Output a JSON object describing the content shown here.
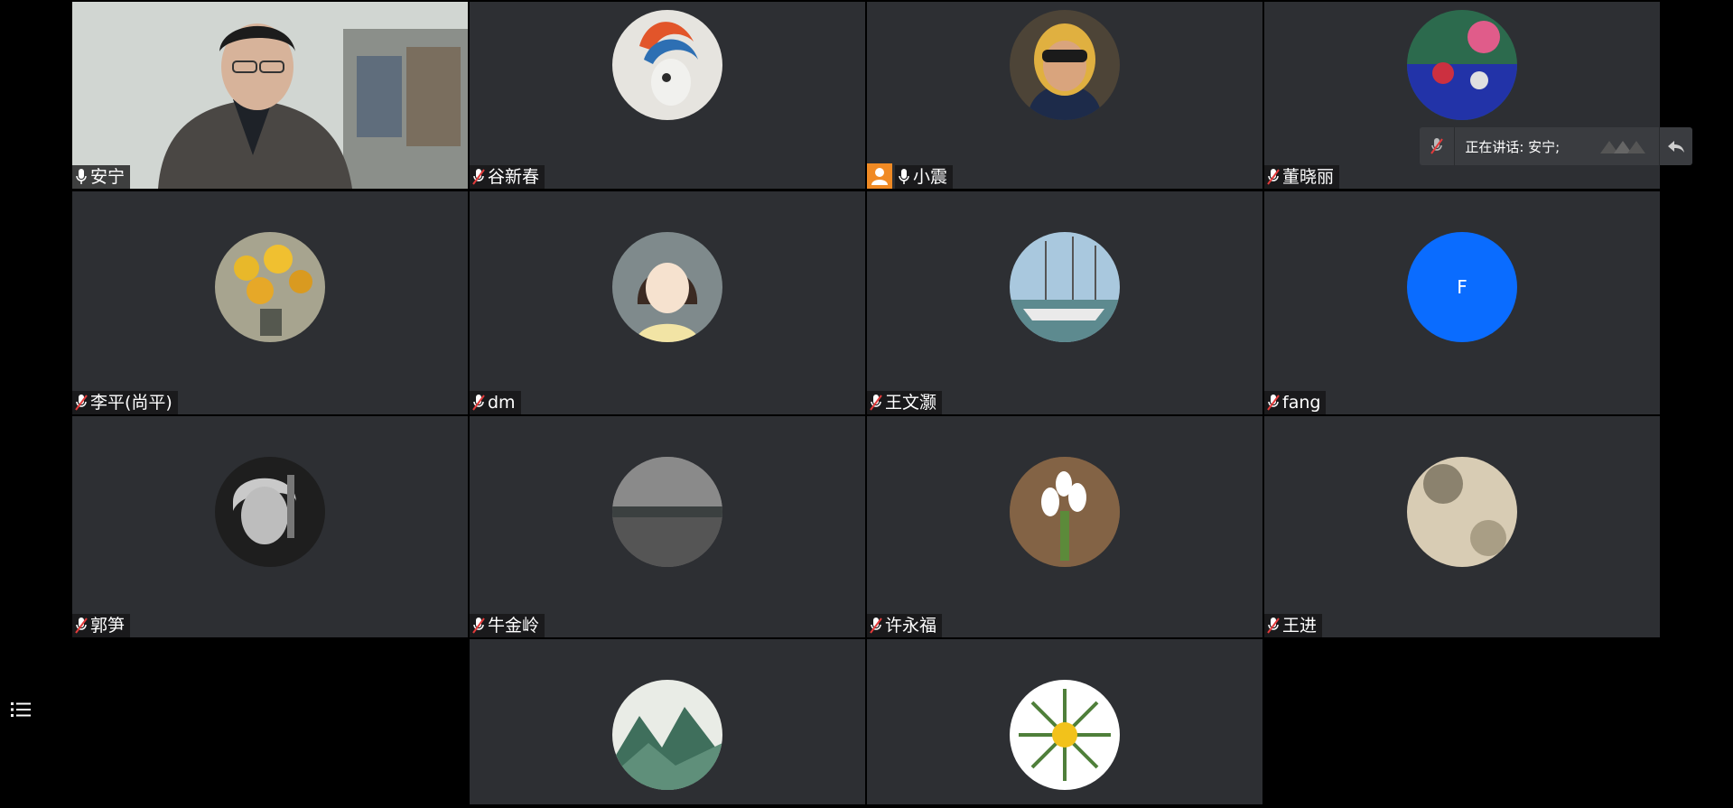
{
  "colors": {
    "tile_bg": "#2d2f33",
    "page_bg": "#000000",
    "speaking_outline": "#3fbf6f",
    "host_badge": "#f08a24",
    "letter_avatar": "#0a6cff"
  },
  "participants": [
    {
      "name": "安宁",
      "mic": "on",
      "video": "on"
    },
    {
      "name": "谷新春",
      "mic": "muted"
    },
    {
      "name": "小震",
      "mic": "on",
      "host": true
    },
    {
      "name": "董晓丽",
      "mic": "muted"
    },
    {
      "name": "李平(尚平)",
      "mic": "muted"
    },
    {
      "name": "dm",
      "mic": "muted"
    },
    {
      "name": "王文灏",
      "mic": "muted"
    },
    {
      "name": "fang",
      "mic": "muted",
      "initial": "F"
    },
    {
      "name": "郭笋",
      "mic": "muted"
    },
    {
      "name": "牛金岭",
      "mic": "muted"
    },
    {
      "name": "许永福",
      "mic": "muted"
    },
    {
      "name": "王进",
      "mic": "muted"
    },
    {
      "name": "",
      "mic": "muted"
    },
    {
      "name": "",
      "mic": "muted"
    }
  ],
  "speaker_panel": {
    "text": "正在讲话: 安宁;",
    "icon": "muted-mic-icon",
    "reply_icon": "reply-arrow-icon"
  },
  "sidebar": {
    "toggle_icon": "list-icon"
  }
}
